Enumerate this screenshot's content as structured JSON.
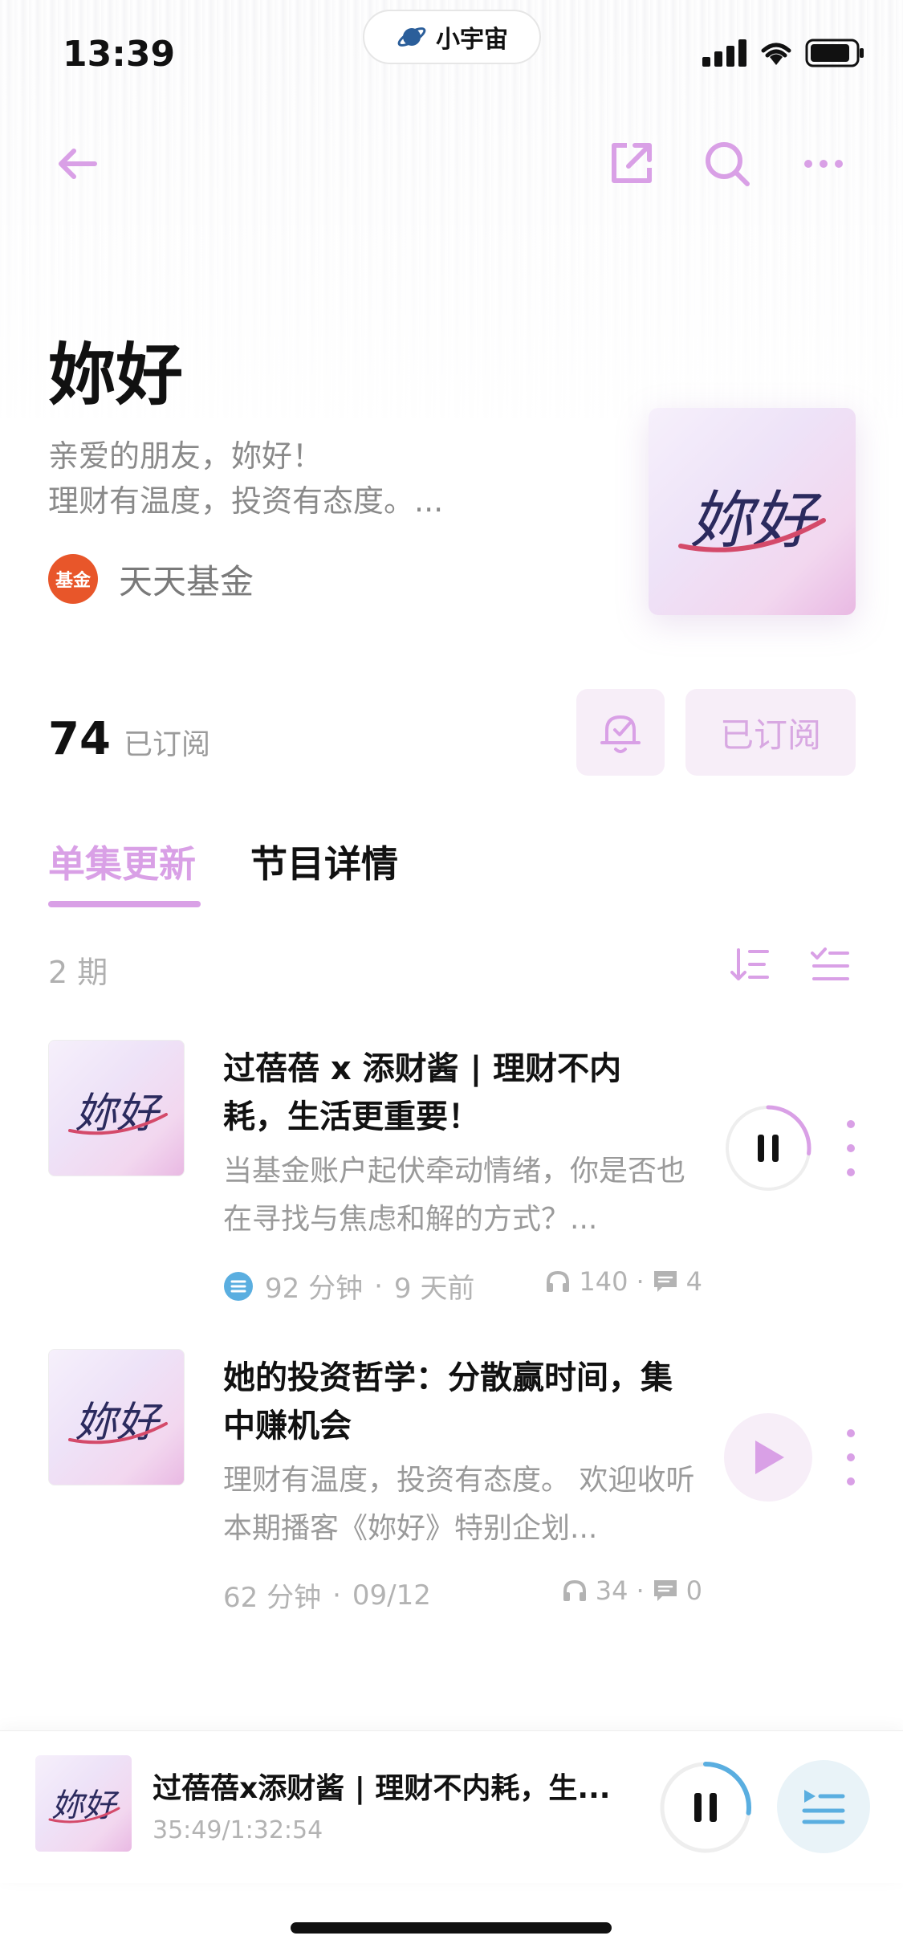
{
  "status_bar": {
    "time": "13:39",
    "app_pill": "小宇宙"
  },
  "podcast": {
    "title": "妳好",
    "description_lines": [
      "亲爱的朋友，妳好！",
      "理财有温度，投资有态度。..."
    ],
    "publisher": "天天基金",
    "publisher_logo_text": "基金",
    "cover_text": "妳好",
    "subscriber_count": "74",
    "subscriber_label": "已订阅",
    "subscribed_button": "已订阅"
  },
  "tabs": [
    {
      "label": "单集更新",
      "active": true
    },
    {
      "label": "节目详情",
      "active": false
    }
  ],
  "episode_count": "2 期",
  "episodes": [
    {
      "title": "过蓓蓓 x 添财酱 | 理财不内耗，生活更重要！",
      "description": "当基金账户起伏牵动情绪，你是否也在寻找与焦虑和解的方式？...",
      "duration": "92 分钟",
      "date": "9 天前",
      "plays": "140",
      "comments": "4",
      "state": "playing",
      "progress": 0.27
    },
    {
      "title": "她的投资哲学：分散赢时间，集中赚机会",
      "description": "理财有温度，投资有态度。 欢迎收听本期播客《妳好》特别企划...",
      "duration": "62 分钟",
      "date": "09/12",
      "plays": "34",
      "comments": "0",
      "state": "paused",
      "progress": 0
    }
  ],
  "player": {
    "title": "过蓓蓓x添财酱 | 理财不内耗，生...",
    "time": "35:49/1:32:54",
    "progress": 0.27
  },
  "colors": {
    "accent": "#d9a0e6",
    "accent_bg": "#f7eef8",
    "player_accent": "#5aaee0",
    "publisher_logo": "#e8562a"
  },
  "icons": [
    "back-arrow-icon",
    "share-icon",
    "search-icon",
    "more-icon",
    "bell-icon",
    "sort-icon",
    "multi-select-icon",
    "pause-icon",
    "play-icon",
    "headphones-icon",
    "comment-icon",
    "transcript-icon",
    "queue-icon"
  ]
}
